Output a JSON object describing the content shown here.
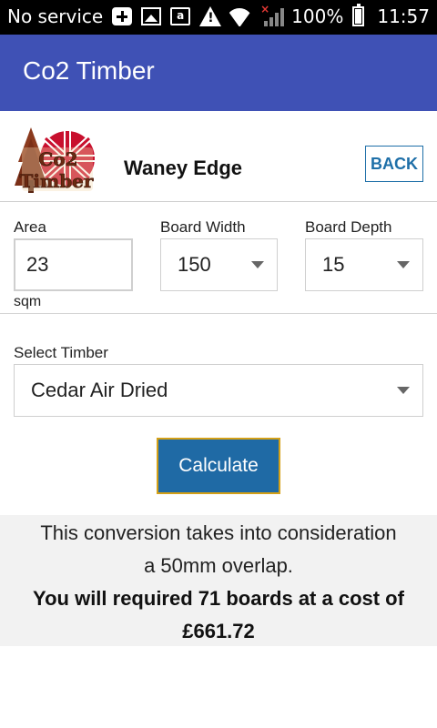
{
  "status_bar": {
    "carrier": "No service",
    "battery": "100%",
    "time": "11:57"
  },
  "app_bar": {
    "title": "Co2 Timber"
  },
  "header": {
    "logo_text": "Co2 Timber",
    "title": "Waney Edge",
    "back_label": "BACK"
  },
  "form": {
    "area_label": "Area",
    "area_value": "23",
    "area_unit": "sqm",
    "board_width_label": "Board Width",
    "board_width_value": "150",
    "board_depth_label": "Board Depth",
    "board_depth_value": "15",
    "select_timber_label": "Select Timber",
    "timber_value": "Cedar Air Dried",
    "calculate_label": "Calculate"
  },
  "result": {
    "line1": "This conversion takes into consideration",
    "line2": "a 50mm overlap.",
    "line3": "You will required 71 boards at a cost of",
    "line4": "£661.72"
  },
  "colors": {
    "app_bar": "#3f51b5",
    "button": "#1f6aa5",
    "button_border": "#d4a017",
    "link": "#1e6fa8"
  }
}
